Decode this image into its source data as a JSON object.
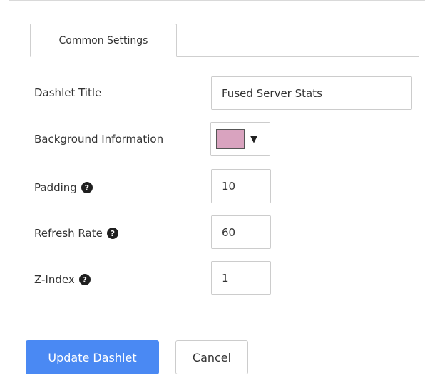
{
  "tabs": [
    {
      "label": "Common Settings",
      "active": true
    }
  ],
  "form": {
    "dashlet_title": {
      "label": "Dashlet Title",
      "value": "Fused Server Stats"
    },
    "background": {
      "label": "Background Information",
      "color": "#d9a3bf"
    },
    "padding": {
      "label": "Padding",
      "value": "10"
    },
    "refresh_rate": {
      "label": "Refresh Rate",
      "value": "60"
    },
    "z_index": {
      "label": "Z-Index",
      "value": "1"
    }
  },
  "icons": {
    "help": "?",
    "dropdown": "▼"
  },
  "actions": {
    "update_label": "Update Dashlet",
    "cancel_label": "Cancel"
  },
  "colors": {
    "primary": "#4a89f3",
    "border": "#cccccc"
  }
}
